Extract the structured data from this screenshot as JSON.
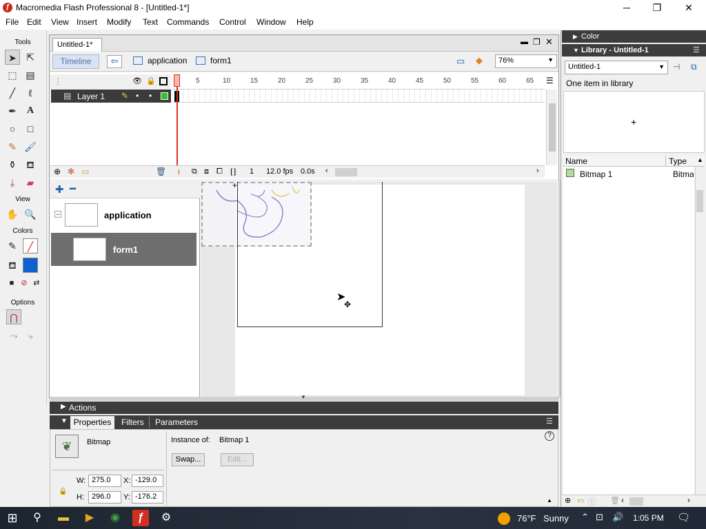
{
  "window": {
    "title": "Macromedia Flash Professional 8 - [Untitled-1*]",
    "controls": {
      "minimize": "─",
      "restore": "❐",
      "close": "✕"
    }
  },
  "menu": [
    "File",
    "Edit",
    "View",
    "Insert",
    "Modify",
    "Text",
    "Commands",
    "Control",
    "Window",
    "Help"
  ],
  "tools": {
    "header": "Tools",
    "view_header": "View",
    "colors_header": "Colors",
    "options_header": "Options"
  },
  "document": {
    "tab": "Untitled-1*",
    "timeline_button": "Timeline",
    "breadcrumb": [
      "application",
      "form1"
    ],
    "zoom": "76%"
  },
  "timeline": {
    "layer_name": "Layer 1",
    "ruler_ticks": [
      "1",
      "5",
      "10",
      "15",
      "20",
      "25",
      "30",
      "35",
      "40",
      "45",
      "50",
      "55",
      "60",
      "65"
    ],
    "current_frame": "1",
    "frame_rate": "12.0 fps",
    "elapsed": "0.0s"
  },
  "outline": {
    "screens": [
      {
        "name": "application",
        "level": 0
      },
      {
        "name": "form1",
        "level": 1,
        "selected": true
      }
    ]
  },
  "actions": {
    "label": "Actions"
  },
  "properties": {
    "tabs": [
      "Properties",
      "Filters",
      "Parameters"
    ],
    "type": "Bitmap",
    "instance_of_label": "Instance of:",
    "instance_of_value": "Bitmap 1",
    "swap_button": "Swap...",
    "edit_button": "Edit...",
    "w_label": "W:",
    "w_value": "275.0",
    "h_label": "H:",
    "h_value": "296.0",
    "x_label": "X:",
    "x_value": "-129.0",
    "y_label": "Y:",
    "y_value": "-176.2"
  },
  "color_panel": {
    "title": "Color"
  },
  "library": {
    "title": "Library - Untitled-1",
    "document_select": "Untitled-1",
    "count": "One item in library",
    "columns": {
      "name": "Name",
      "type": "Type"
    },
    "items": [
      {
        "name": "Bitmap 1",
        "type": "Bitmap"
      }
    ]
  },
  "taskbar": {
    "weather_temp": "76°F",
    "weather_text": "Sunny",
    "time": "1:05 PM"
  }
}
